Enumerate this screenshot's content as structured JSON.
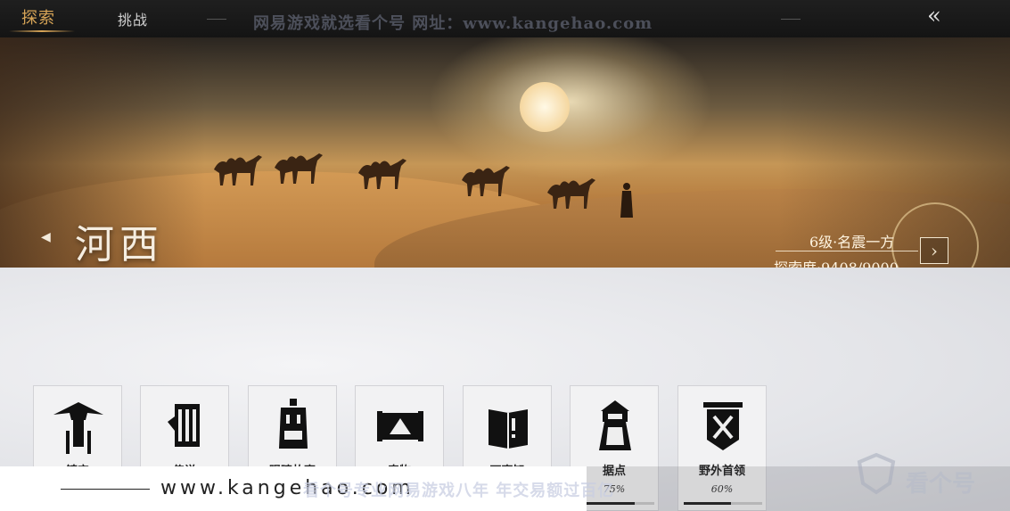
{
  "tabs": [
    {
      "label": "探索",
      "active": true
    },
    {
      "label": "挑战",
      "active": false
    }
  ],
  "watermark_top": "网易游戏就选看个号 网址：www.kangehao.com",
  "back_icon": "double-chevron-left-icon",
  "region": {
    "name": "河西",
    "rank": "6级·名震一方",
    "exploration": "探索度·9408/9000"
  },
  "cards": [
    {
      "label": "镇守",
      "icon": "hat-icon"
    },
    {
      "label": "传说",
      "icon": "scroll-icon"
    },
    {
      "label": "眼睛故事",
      "icon": "bell-icon"
    },
    {
      "label": "奇物",
      "icon": "map-scroll-icon"
    },
    {
      "label": "万事知",
      "icon": "book-icon"
    },
    {
      "label": "据点",
      "icon": "watchtower-icon",
      "percent": "75%",
      "progress": 0.75
    },
    {
      "label": "野外首领",
      "icon": "crossed-swords-icon",
      "percent": "60%",
      "progress": 0.6
    }
  ],
  "watermark_bottom": {
    "url": "www.kangehao.com",
    "slogan": "看个号专业网易游戏八年 年交易额过百亿",
    "logo": "看个号"
  }
}
